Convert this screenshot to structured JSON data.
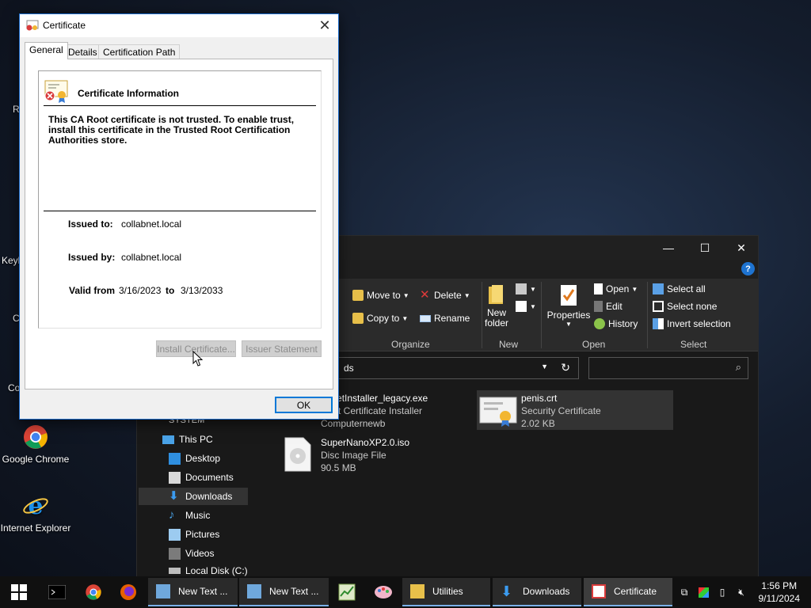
{
  "desktop": {
    "icons": [
      {
        "label": "Google Chrome"
      },
      {
        "label": "Internet Explorer"
      }
    ],
    "clipped_labels": [
      "R",
      "Keyl",
      "C",
      "Co"
    ]
  },
  "explorer": {
    "window_buttons": {
      "minimize": "—",
      "maximize": "☐",
      "close": "✕"
    },
    "help": "?",
    "ribbon": {
      "organize": {
        "move_to": "Move to",
        "copy_to": "Copy to",
        "delete": "Delete",
        "rename": "Rename",
        "group": "Organize"
      },
      "new": {
        "new_folder_line1": "New",
        "new_folder_line2": "folder",
        "group": "New"
      },
      "open": {
        "properties": "Properties",
        "open": "Open",
        "edit": "Edit",
        "history": "History",
        "group": "Open"
      },
      "select": {
        "select_all": "Select all",
        "select_none": "Select none",
        "invert": "Invert selection",
        "group": "Select"
      }
    },
    "address_text": "ds",
    "nav": {
      "system": "SYSTEM",
      "this_pc": "This PC",
      "desktop": "Desktop",
      "documents": "Documents",
      "downloads": "Downloads",
      "music": "Music",
      "pictures": "Pictures",
      "videos": "Videos",
      "local_disk": "Local Disk (C:)"
    },
    "files": [
      {
        "name": "abnetInstaller_legacy.exe",
        "type": "bNet Certificate Installer",
        "detail": "Computernewb"
      },
      {
        "name": "penis.crt",
        "type": "Security Certificate",
        "detail": "2.02 KB"
      },
      {
        "name": "SuperNanoXP2.0.iso",
        "type": "Disc Image File",
        "detail": "90.5 MB"
      }
    ]
  },
  "certificate": {
    "title": "Certificate",
    "tabs": [
      "General",
      "Details",
      "Certification Path"
    ],
    "heading": "Certificate Information",
    "warning": "This CA Root certificate is not trusted. To enable trust, install this certificate in the Trusted Root Certification Authorities store.",
    "issued_to_label": "Issued to:",
    "issued_to": "collabnet.local",
    "issued_by_label": "Issued by:",
    "issued_by": "collabnet.local",
    "valid_from_label": "Valid from",
    "valid_from": "3/16/2023",
    "to_label": "to",
    "valid_to": "3/13/2033",
    "install_button": "Install Certificate...",
    "issuer_button": "Issuer Statement",
    "ok_button": "OK"
  },
  "taskbar": {
    "buttons": [
      {
        "label": "New Text ..."
      },
      {
        "label": "New Text ..."
      },
      {
        "label": "Utilities"
      },
      {
        "label": "Downloads"
      },
      {
        "label": "Certificate"
      }
    ],
    "clock": {
      "time": "1:56 PM",
      "date": "9/11/2024"
    }
  },
  "colors": {
    "accent": "#0078d7",
    "explorer_bg": "#191919",
    "ribbon_bg": "#2b2b2b",
    "taskbar_bg": "#101010"
  }
}
